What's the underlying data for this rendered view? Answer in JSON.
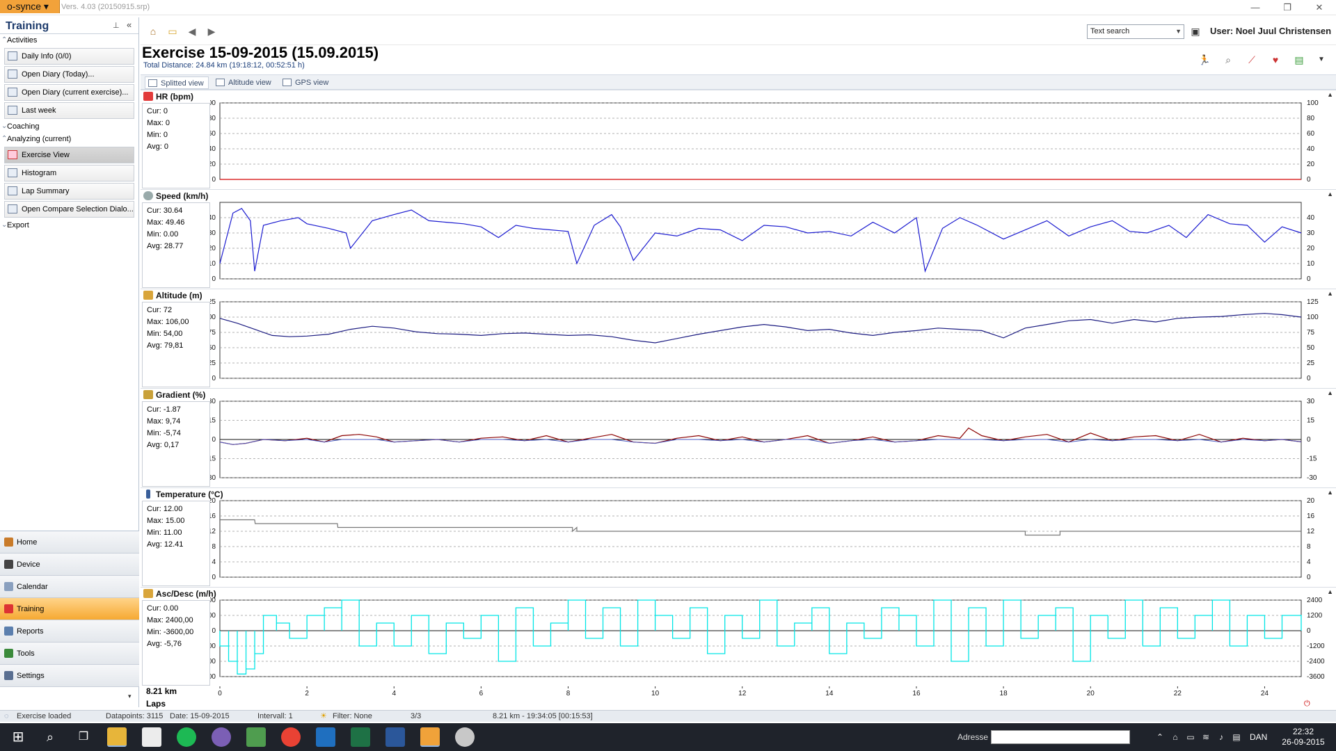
{
  "app": {
    "menu_label": "o-synce ▾",
    "version": "Vers. 4.03 (20150915.srp)"
  },
  "window_controls": {
    "minimize": "—",
    "maximize": "❐",
    "close": "✕"
  },
  "sidebar": {
    "title": "Training",
    "pin_icon": "pin-icon",
    "collapse_icon": "double-chevron-left-icon",
    "sections": {
      "activities": "Activities",
      "coaching": "Coaching",
      "analyzing": "Analyzing (current)",
      "export": "Export"
    },
    "activities_items": [
      {
        "label": "Daily Info (0/0)",
        "icon": "calendar-icon"
      },
      {
        "label": "Open Diary (Today)...",
        "icon": "diary-icon"
      },
      {
        "label": "Open Diary (current exercise)...",
        "icon": "diary-icon"
      },
      {
        "label": "Last week",
        "icon": "week-icon"
      }
    ],
    "analyzing_items": [
      {
        "label": "Exercise View",
        "icon": "exercise-view-icon",
        "selected": true
      },
      {
        "label": "Histogram",
        "icon": "histogram-icon"
      },
      {
        "label": "Lap Summary",
        "icon": "lap-summary-icon"
      },
      {
        "label": "Open Compare Selection Dialo...",
        "icon": "compare-icon"
      }
    ]
  },
  "nav": [
    {
      "label": "Home",
      "icon": "home-icon"
    },
    {
      "label": "Device",
      "icon": "device-icon"
    },
    {
      "label": "Calendar",
      "icon": "calendar-icon"
    },
    {
      "label": "Training",
      "icon": "training-icon",
      "active": true
    },
    {
      "label": "Reports",
      "icon": "reports-icon"
    },
    {
      "label": "Tools",
      "icon": "tools-icon"
    },
    {
      "label": "Settings",
      "icon": "settings-icon"
    }
  ],
  "toolbar": {
    "search_value": "Text search",
    "user": "User: Noel Juul Christensen"
  },
  "exercise": {
    "title": "Exercise 15-09-2015 (15.09.2015)",
    "subtitle": "Total Distance: 24.84 km (19:18:12, 00:52:51 h)"
  },
  "view_tabs": [
    "Splitted view",
    "Altitude view",
    "GPS view"
  ],
  "panels": [
    {
      "title": "HR (bpm)",
      "stats": [
        "Cur: 0",
        "Max: 0",
        "Min: 0",
        "Avg: 0"
      ]
    },
    {
      "title": "Speed (km/h)",
      "stats": [
        "Cur: 30.64",
        "Max: 49.46",
        "Min: 0.00",
        "Avg: 28.77"
      ]
    },
    {
      "title": "Altitude (m)",
      "stats": [
        "Cur: 72",
        "Max: 106,00",
        "Min: 54,00",
        "Avg: 79,81"
      ]
    },
    {
      "title": "Gradient (%)",
      "stats": [
        "Cur: -1.87",
        "Max: 9,74",
        "Min: -5,74",
        "Avg: 0,17"
      ]
    },
    {
      "title": "Temperature (°C)",
      "stats": [
        "Cur: 12.00",
        "Max: 15.00",
        "Min: 11.00",
        "Avg: 12.41"
      ]
    },
    {
      "title": "Asc/Desc (m/h)",
      "stats": [
        "Cur: 0.00",
        "Max: 2400,00",
        "Min: -3600,00",
        "Avg: -5,76"
      ]
    }
  ],
  "chart_data": [
    {
      "type": "line",
      "title": "HR (bpm)",
      "ylim": [
        0,
        100
      ],
      "yticks": [
        0,
        20,
        40,
        60,
        80,
        100
      ],
      "xlim": [
        0,
        24.84
      ],
      "color": "#d40000",
      "x": [
        0,
        24.84
      ],
      "y": [
        0,
        0
      ]
    },
    {
      "type": "line",
      "title": "Speed (km/h)",
      "ylim": [
        0,
        50
      ],
      "yticks": [
        0,
        10,
        20,
        30,
        40
      ],
      "xlim": [
        0,
        24.84
      ],
      "color": "#1a1ad0",
      "x": [
        0,
        0.3,
        0.5,
        0.7,
        0.8,
        1,
        1.4,
        1.8,
        2,
        2.5,
        2.9,
        3,
        3.5,
        4,
        4.4,
        4.8,
        5.2,
        5.6,
        6,
        6.4,
        6.8,
        7.2,
        8,
        8.2,
        8.6,
        9,
        9.2,
        9.5,
        10,
        10.5,
        11,
        11.5,
        12,
        12.5,
        13,
        13.5,
        14,
        14.5,
        15,
        15.5,
        16,
        16.2,
        16.6,
        17,
        17.4,
        18,
        18.5,
        19,
        19.5,
        20,
        20.5,
        20.9,
        21.3,
        21.8,
        22.2,
        22.7,
        23.2,
        23.6,
        24,
        24.4,
        24.84
      ],
      "y": [
        10,
        43,
        46,
        38,
        5,
        35,
        38,
        40,
        36,
        33,
        30,
        20,
        38,
        42,
        45,
        38,
        37,
        36,
        34,
        27,
        35,
        33,
        31,
        10,
        35,
        42,
        34,
        12,
        30,
        28,
        33,
        32,
        25,
        35,
        34,
        30,
        31,
        28,
        37,
        30,
        40,
        5,
        33,
        40,
        35,
        26,
        32,
        38,
        28,
        34,
        38,
        31,
        30,
        35,
        27,
        42,
        36,
        35,
        24,
        34,
        30
      ]
    },
    {
      "type": "line",
      "title": "Altitude (m)",
      "ylim": [
        0,
        125
      ],
      "yticks": [
        0,
        25,
        50,
        75,
        100,
        125
      ],
      "xlim": [
        0,
        24.84
      ],
      "color": "#1a1a80",
      "x": [
        0,
        0.4,
        0.8,
        1.2,
        1.6,
        2,
        2.5,
        3,
        3.5,
        4,
        4.5,
        5,
        5.5,
        6,
        6.5,
        7,
        7.5,
        8,
        8.5,
        9,
        9.5,
        10,
        10.5,
        11,
        11.5,
        12,
        12.5,
        13,
        13.5,
        14,
        14.5,
        15,
        15.5,
        16,
        16.5,
        17,
        17.5,
        18,
        18.5,
        19,
        19.5,
        20,
        20.5,
        21,
        21.5,
        22,
        22.5,
        23,
        23.5,
        24,
        24.4,
        24.84
      ],
      "y": [
        98,
        90,
        80,
        70,
        68,
        69,
        72,
        80,
        85,
        82,
        76,
        73,
        72,
        70,
        73,
        74,
        72,
        70,
        71,
        68,
        62,
        58,
        65,
        72,
        78,
        84,
        88,
        84,
        78,
        80,
        74,
        70,
        75,
        78,
        82,
        80,
        78,
        66,
        82,
        88,
        94,
        96,
        90,
        96,
        92,
        98,
        100,
        101,
        104,
        106,
        104,
        100,
        96
      ]
    },
    {
      "type": "line",
      "title": "Gradient (%)",
      "ylim": [
        -30,
        30
      ],
      "yticks": [
        -30,
        -15,
        0,
        15,
        30
      ],
      "xlim": [
        0,
        24.84
      ],
      "color": "#8b0000",
      "x": [
        0,
        0.3,
        0.6,
        1,
        1.5,
        2,
        2.4,
        2.8,
        3.2,
        3.6,
        4,
        4.5,
        5,
        5.5,
        6,
        6.5,
        7,
        7.5,
        8,
        8.5,
        9,
        9.5,
        10,
        10.5,
        11,
        11.5,
        12,
        12.5,
        13,
        13.5,
        14,
        14.5,
        15,
        15.5,
        16,
        16.5,
        17,
        17.2,
        17.5,
        18,
        18.5,
        19,
        19.5,
        20,
        20.5,
        21,
        21.5,
        22,
        22.5,
        23,
        23.5,
        24,
        24.4,
        24.84
      ],
      "y": [
        -2,
        -4,
        -3,
        0,
        -1,
        1,
        -2,
        3,
        4,
        2,
        -2,
        -1,
        0,
        -2,
        1,
        2,
        -1,
        3,
        -2,
        1,
        4,
        -2,
        -3,
        1,
        3,
        -1,
        2,
        -2,
        0,
        3,
        -3,
        -1,
        2,
        -2,
        -1,
        3,
        1,
        9,
        3,
        -1,
        2,
        4,
        -2,
        5,
        -1,
        2,
        3,
        -1,
        4,
        -2,
        1,
        -1,
        0,
        -1.87
      ]
    },
    {
      "type": "line",
      "title": "Temperature (°C)",
      "ylim": [
        0,
        20
      ],
      "yticks": [
        0,
        4,
        8,
        12,
        16,
        20
      ],
      "xlim": [
        0,
        24.84
      ],
      "color": "#777777",
      "x": [
        0,
        0.8,
        0.81,
        2.7,
        2.71,
        8.1,
        8.1,
        8.2,
        8.2,
        18.5,
        18.5,
        19.3,
        19.3,
        24.84
      ],
      "y": [
        15,
        15,
        14,
        14,
        13,
        13,
        12,
        13,
        12,
        12,
        11,
        11,
        12,
        12
      ]
    },
    {
      "type": "line",
      "title": "Asc/Desc (m/h)",
      "ylim": [
        -3600,
        2400
      ],
      "yticks": [
        -3600,
        -2400,
        -1200,
        0,
        1200,
        2400
      ],
      "xlim": [
        0,
        24.84
      ],
      "color": "#00e5e5",
      "x": [
        0,
        0.2,
        0.4,
        0.6,
        0.8,
        1,
        1.3,
        1.6,
        2,
        2.4,
        2.8,
        3.2,
        3.6,
        4,
        4.4,
        4.8,
        5.2,
        5.6,
        6,
        6.4,
        6.8,
        7.2,
        7.6,
        8,
        8.4,
        8.8,
        9.2,
        9.6,
        10,
        10.4,
        10.8,
        11.2,
        11.6,
        12,
        12.4,
        12.8,
        13.2,
        13.6,
        14,
        14.4,
        14.8,
        15.2,
        15.6,
        16,
        16.4,
        16.8,
        17.2,
        17.6,
        18,
        18.4,
        18.8,
        19.2,
        19.6,
        20,
        20.4,
        20.8,
        21.2,
        21.6,
        22,
        22.4,
        22.8,
        23.2,
        23.6,
        24,
        24.4,
        24.84
      ],
      "y": [
        -1200,
        -2400,
        -3400,
        -3000,
        -1800,
        1200,
        600,
        -600,
        1200,
        1800,
        2400,
        -1200,
        600,
        -1200,
        1200,
        -1800,
        600,
        -600,
        1200,
        -2400,
        1800,
        -1200,
        600,
        2400,
        -600,
        1800,
        -1200,
        2400,
        1200,
        -600,
        1800,
        -1800,
        1200,
        -600,
        2400,
        -1200,
        600,
        1800,
        -1800,
        600,
        -600,
        1800,
        1200,
        -1200,
        2400,
        -2400,
        1800,
        -1200,
        2400,
        -600,
        1200,
        1800,
        -2400,
        1200,
        -600,
        2400,
        -1200,
        1800,
        -600,
        1200,
        2400,
        -1200,
        1200,
        -600,
        1200,
        0
      ]
    }
  ],
  "x_axis": {
    "ticks": [
      0,
      2,
      4,
      6,
      8,
      10,
      12,
      14,
      16,
      18,
      20,
      22,
      24
    ],
    "max": 24.84
  },
  "bottom": {
    "cursor": "8.21 km",
    "laps": "Laps"
  },
  "statusbar": {
    "loaded": "Exercise loaded",
    "datapoints": "Datapoints: 3115",
    "date": "Date: 15-09-2015",
    "interval": "Intervall: 1",
    "filter": "Filter: None",
    "page": "3/3",
    "position": "8.21 km - 19:34:05 [00:15:53]"
  },
  "taskbar": {
    "address_label": "Adresse",
    "language": "DAN",
    "time": "22:32",
    "date": "26-09-2015"
  }
}
